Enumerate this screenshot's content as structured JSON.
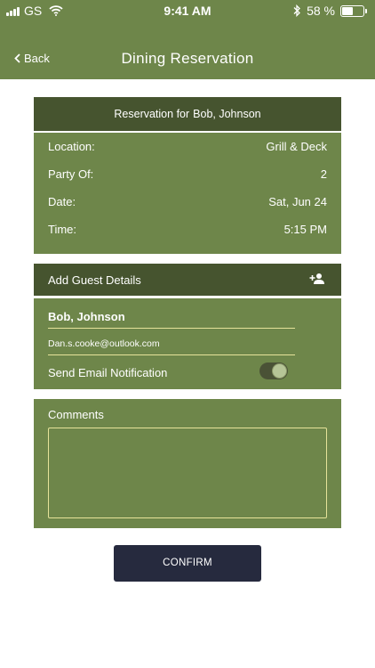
{
  "status_bar": {
    "carrier": "GS",
    "time": "9:41 AM",
    "battery_percent_text": "58 %",
    "battery_level": 0.58
  },
  "nav": {
    "back_label": "Back",
    "title": "Dining Reservation"
  },
  "reservation": {
    "header_prefix": "Reservation for",
    "guest_name": "Bob, Johnson",
    "rows": [
      {
        "label": "Location:",
        "value": "Grill & Deck"
      },
      {
        "label": "Party Of:",
        "value": "2"
      },
      {
        "label": "Date:",
        "value": "Sat, Jun 24"
      },
      {
        "label": "Time:",
        "value": "5:15 PM"
      }
    ]
  },
  "guest_details": {
    "header": "Add Guest Details",
    "name": "Bob, Johnson",
    "email": "Dan.s.cooke@outlook.com",
    "notify_label": "Send Email Notification",
    "notify_on": true
  },
  "comments": {
    "label": "Comments",
    "value": ""
  },
  "confirm_label": "CONFIRM",
  "colors": {
    "primary_green": "#6e864a",
    "dark_green": "#46542f",
    "accent_yellow": "#e6e39a",
    "button_navy": "#262a3e"
  }
}
